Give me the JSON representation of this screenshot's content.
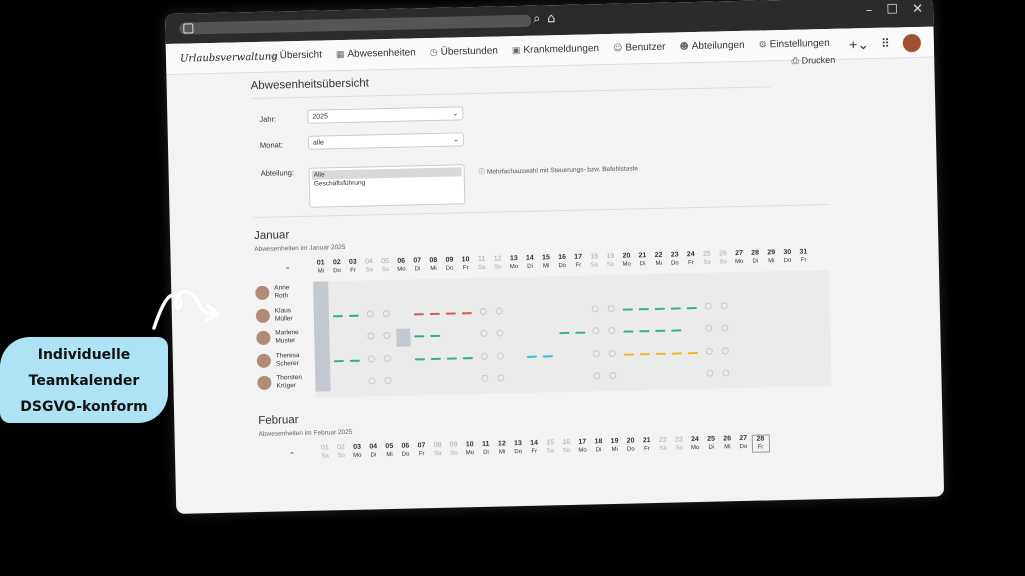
{
  "nav": {
    "logo": "Urlaubsverwaltung",
    "items": [
      {
        "label": "Übersicht",
        "icon": "home-icon",
        "glyph": "⌂"
      },
      {
        "label": "Abwesenheiten",
        "icon": "calendar-icon",
        "glyph": "▦"
      },
      {
        "label": "Überstunden",
        "icon": "clock-icon",
        "glyph": "◷"
      },
      {
        "label": "Krankmeldungen",
        "icon": "medical-bag-icon",
        "glyph": "▣"
      },
      {
        "label": "Benutzer",
        "icon": "user-icon",
        "glyph": "☺"
      },
      {
        "label": "Abteilungen",
        "icon": "users-icon",
        "glyph": "☻"
      },
      {
        "label": "Einstellungen",
        "icon": "gear-icon",
        "glyph": "⚙"
      }
    ]
  },
  "page": {
    "title": "Abwesenheitsübersicht",
    "print_label": "Drucken"
  },
  "filters": {
    "year_label": "Jahr:",
    "year_value": "2025",
    "month_label": "Monat:",
    "month_value": "alle",
    "department_label": "Abteilung:",
    "department_options": [
      "Alle",
      "Geschäftsführung"
    ],
    "department_selected": "Alle",
    "hint": "Mehrfachauswahl mit Steuerungs- bzw. Befehlstaste"
  },
  "january": {
    "title": "Januar",
    "subtitle": "Abwesenheiten im Januar 2025",
    "days": [
      {
        "n": "01",
        "w": "Mi",
        "we": false
      },
      {
        "n": "02",
        "w": "Do",
        "we": false
      },
      {
        "n": "03",
        "w": "Fr",
        "we": false
      },
      {
        "n": "04",
        "w": "Sa",
        "we": true
      },
      {
        "n": "05",
        "w": "So",
        "we": true
      },
      {
        "n": "06",
        "w": "Mo",
        "we": false
      },
      {
        "n": "07",
        "w": "Di",
        "we": false
      },
      {
        "n": "08",
        "w": "Mi",
        "we": false
      },
      {
        "n": "09",
        "w": "Do",
        "we": false
      },
      {
        "n": "10",
        "w": "Fr",
        "we": false
      },
      {
        "n": "11",
        "w": "Sa",
        "we": true
      },
      {
        "n": "12",
        "w": "So",
        "we": true
      },
      {
        "n": "13",
        "w": "Mo",
        "we": false
      },
      {
        "n": "14",
        "w": "Di",
        "we": false
      },
      {
        "n": "15",
        "w": "Mi",
        "we": false
      },
      {
        "n": "16",
        "w": "Do",
        "we": false
      },
      {
        "n": "17",
        "w": "Fr",
        "we": false
      },
      {
        "n": "18",
        "w": "Sa",
        "we": true
      },
      {
        "n": "19",
        "w": "So",
        "we": true
      },
      {
        "n": "20",
        "w": "Mo",
        "we": false
      },
      {
        "n": "21",
        "w": "Di",
        "we": false
      },
      {
        "n": "22",
        "w": "Mi",
        "we": false
      },
      {
        "n": "23",
        "w": "Do",
        "we": false
      },
      {
        "n": "24",
        "w": "Fr",
        "we": false
      },
      {
        "n": "25",
        "w": "Sa",
        "we": true
      },
      {
        "n": "26",
        "w": "So",
        "we": true
      },
      {
        "n": "27",
        "w": "Mo",
        "we": false
      },
      {
        "n": "28",
        "w": "Di",
        "we": false
      },
      {
        "n": "29",
        "w": "Mi",
        "we": false
      },
      {
        "n": "30",
        "w": "Do",
        "we": false
      },
      {
        "n": "31",
        "w": "Fr",
        "we": false
      }
    ],
    "employees": [
      {
        "first": "Anne",
        "last": "Roth"
      },
      {
        "first": "Klaus",
        "last": "Müller"
      },
      {
        "first": "Marlene",
        "last": "Muster"
      },
      {
        "first": "Theresa",
        "last": "Scherer"
      },
      {
        "first": "Thorsten",
        "last": "Krüger"
      }
    ],
    "absences": [
      {
        "row": 1,
        "from": 2,
        "to": 3,
        "type": "vacation"
      },
      {
        "row": 1,
        "from": 7,
        "to": 10,
        "type": "sick"
      },
      {
        "row": 1,
        "from": 20,
        "to": 24,
        "type": "vacation"
      },
      {
        "row": 2,
        "from": 6,
        "to": 6,
        "type": "pending"
      },
      {
        "row": 2,
        "from": 7,
        "to": 8,
        "type": "vacation"
      },
      {
        "row": 2,
        "from": 16,
        "to": 17,
        "type": "vacation"
      },
      {
        "row": 2,
        "from": 20,
        "to": 23,
        "type": "vacation"
      },
      {
        "row": 3,
        "from": 2,
        "to": 3,
        "type": "vacation"
      },
      {
        "row": 3,
        "from": 7,
        "to": 10,
        "type": "vacation"
      },
      {
        "row": 3,
        "from": 14,
        "to": 15,
        "type": "special"
      },
      {
        "row": 3,
        "from": 20,
        "to": 24,
        "type": "overtime"
      }
    ],
    "colors": {
      "vacation": "#2bb673",
      "sick": "#e05555",
      "special": "#2ec4d6",
      "overtime": "#f0b429",
      "pending": "#c3c7cf"
    }
  },
  "february": {
    "title": "Februar",
    "subtitle": "Abwesenheiten im Februar 2025",
    "days": [
      {
        "n": "01",
        "w": "Sa",
        "we": true
      },
      {
        "n": "02",
        "w": "So",
        "we": true
      },
      {
        "n": "03",
        "w": "Mo",
        "we": false
      },
      {
        "n": "04",
        "w": "Di",
        "we": false
      },
      {
        "n": "05",
        "w": "Mi",
        "we": false
      },
      {
        "n": "06",
        "w": "Do",
        "we": false
      },
      {
        "n": "07",
        "w": "Fr",
        "we": false
      },
      {
        "n": "08",
        "w": "Sa",
        "we": true
      },
      {
        "n": "09",
        "w": "So",
        "we": true
      },
      {
        "n": "10",
        "w": "Mo",
        "we": false
      },
      {
        "n": "11",
        "w": "Di",
        "we": false
      },
      {
        "n": "12",
        "w": "Mi",
        "we": false
      },
      {
        "n": "13",
        "w": "Do",
        "we": false
      },
      {
        "n": "14",
        "w": "Fr",
        "we": false
      },
      {
        "n": "15",
        "w": "Sa",
        "we": true
      },
      {
        "n": "16",
        "w": "So",
        "we": true
      },
      {
        "n": "17",
        "w": "Mo",
        "we": false
      },
      {
        "n": "18",
        "w": "Di",
        "we": false
      },
      {
        "n": "19",
        "w": "Mi",
        "we": false
      },
      {
        "n": "20",
        "w": "Do",
        "we": false
      },
      {
        "n": "21",
        "w": "Fr",
        "we": false
      },
      {
        "n": "22",
        "w": "Sa",
        "we": true
      },
      {
        "n": "23",
        "w": "So",
        "we": true
      },
      {
        "n": "24",
        "w": "Mo",
        "we": false
      },
      {
        "n": "25",
        "w": "Di",
        "we": false
      },
      {
        "n": "26",
        "w": "Mi",
        "we": false
      },
      {
        "n": "27",
        "w": "Do",
        "we": false
      },
      {
        "n": "28",
        "w": "Fr",
        "we": false,
        "today": true
      }
    ]
  },
  "badge": {
    "line1": "Individuelle",
    "line2": "Teamkalender",
    "line3": "DSGVO-konform"
  }
}
